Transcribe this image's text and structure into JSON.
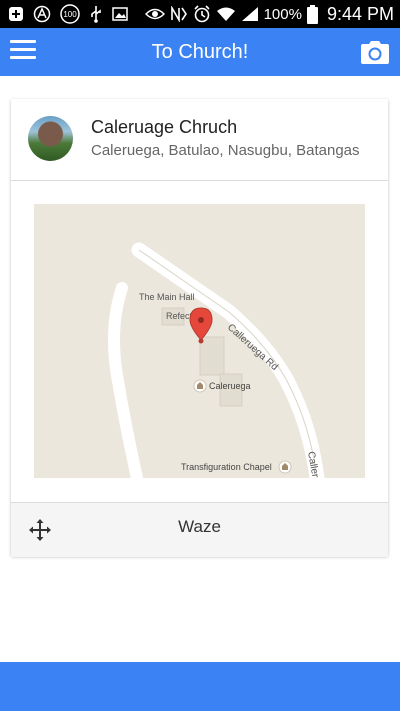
{
  "status_bar": {
    "battery_percent": "100%",
    "time": "9:44 PM",
    "notification_badge": "100"
  },
  "app_bar": {
    "title": "To Church!"
  },
  "church_card": {
    "name": "Caleruage Chruch",
    "address": "Caleruega, Batulao, Nasugbu, Batangas"
  },
  "map": {
    "labels": {
      "main_hall": "The Main Hall",
      "refectory": "Refecto",
      "road": "Calleruega Rd",
      "road_partial": "Caller",
      "caleruega": "Caleruega",
      "chapel": "Transfiguration Chapel"
    }
  },
  "footer": {
    "waze_label": "Waze"
  },
  "colors": {
    "accent": "#3b82f4",
    "map_background": "#ebe7dc",
    "pin": "#e5483b"
  }
}
